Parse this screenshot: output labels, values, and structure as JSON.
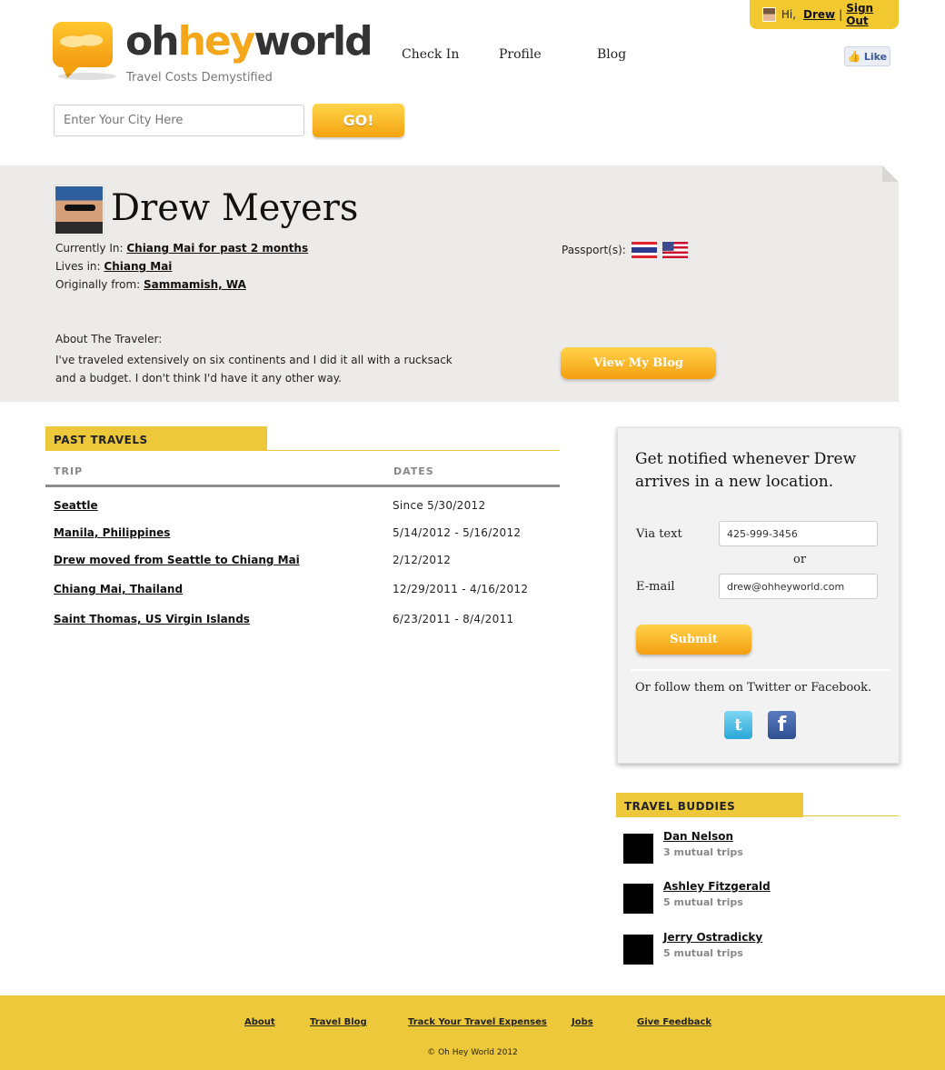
{
  "user": {
    "greeting": "Hi,",
    "name": "Drew",
    "sign_out": "Sign Out"
  },
  "brand": {
    "oh": "oh",
    "hey": "hey",
    "world": "world",
    "tagline": "Travel Costs Demystified"
  },
  "nav": [
    "Check In",
    "Profile",
    "Blog"
  ],
  "fb_like": "Like",
  "search": {
    "placeholder": "Enter Your City Here",
    "go": "GO!"
  },
  "profile": {
    "name": "Drew Meyers",
    "currently_label": "Currently In:",
    "currently_value": "Chiang Mai for past 2 months",
    "lives_label": "Lives in:",
    "lives_value": "Chiang Mai",
    "origin_label": "Originally from:",
    "origin_value": "Sammamish, WA",
    "passport_label": "Passport(s):",
    "passports": [
      "thailand-flag-icon",
      "usa-flag-icon"
    ],
    "about_label": "About The Traveler:",
    "about_text": "I've traveled extensively on six continents and I did it all with a rucksack and a budget. I don't think I'd have it any other way.",
    "blog_button": "View My Blog"
  },
  "travels": {
    "title": "PAST TRAVELS",
    "col_trip": "TRIP",
    "col_dates": "DATES",
    "rows": [
      {
        "trip": "Seattle",
        "dates": "Since 5/30/2012"
      },
      {
        "trip": "Manila, Philippines",
        "dates": "5/14/2012 - 5/16/2012"
      },
      {
        "trip": "Drew moved from Seattle to Chiang Mai",
        "dates": "2/12/2012"
      },
      {
        "trip": "Chiang Mai, Thailand",
        "dates": "12/29/2011 - 4/16/2012"
      },
      {
        "trip": "Saint Thomas, US Virgin Islands",
        "dates": "6/23/2011 - 8/4/2011"
      }
    ]
  },
  "notify": {
    "heading": "Get notified whenever Drew arrives in a new location.",
    "text_label": "Via text",
    "text_value": "425-999-3456",
    "or": "or",
    "email_label": "E-mail",
    "email_value": "drew@ohheyworld.com",
    "submit": "Submit",
    "follow": "Or follow them on Twitter or Facebook.",
    "twitter_glyph": "t",
    "facebook_glyph": "f"
  },
  "buddies": {
    "title": "TRAVEL BUDDIES",
    "items": [
      {
        "name": "Dan Nelson",
        "mutual": "3 mutual trips"
      },
      {
        "name": "Ashley Fitzgerald",
        "mutual": "5 mutual trips"
      },
      {
        "name": "Jerry Ostradicky",
        "mutual": "5 mutual trips"
      }
    ]
  },
  "footer": {
    "links": [
      "About",
      "Travel Blog",
      "Track Your Travel Expenses",
      "Jobs",
      "Give Feedback"
    ],
    "copyright": "© Oh Hey World 2012"
  },
  "colors": {
    "accent": "#ecc83a",
    "orange": "#f4a71a",
    "banner": "#ecebe9"
  }
}
